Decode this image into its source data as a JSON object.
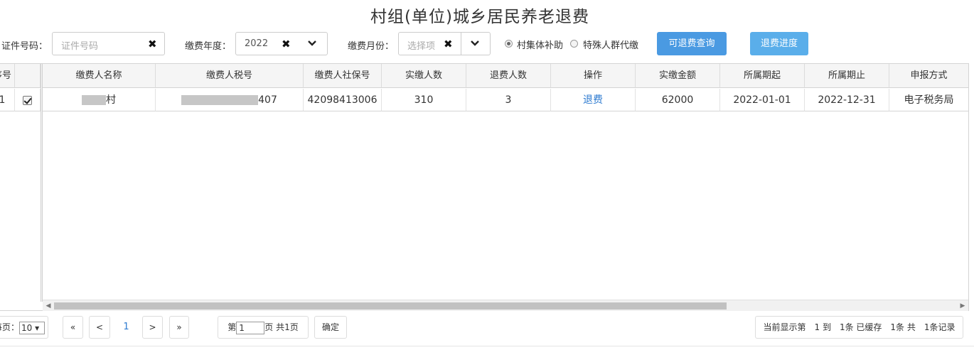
{
  "title": "村组(单位)城乡居民养老退费",
  "filters": {
    "id_label": "证件号码：",
    "id_placeholder": "证件号码",
    "year_label": "缴费年度：",
    "year_value": "2022",
    "month_label": "缴费月份：",
    "month_placeholder": "选择项",
    "radio1": "村集体补助",
    "radio2": "特殊人群代缴",
    "btn_query": "可退费查询",
    "btn_progress": "退费进度"
  },
  "table": {
    "headers": {
      "seq": "序号",
      "name": "缴费人名称",
      "tax": "缴费人税号",
      "ssn": "缴费人社保号",
      "paid_count": "实缴人数",
      "refund_count": "退费人数",
      "op": "操作",
      "amount": "实缴金额",
      "start": "所属期起",
      "end": "所属期止",
      "method": "申报方式"
    },
    "row": {
      "seq": "1",
      "name_suffix": "村",
      "tax_suffix": "407",
      "ssn": "42098413006",
      "paid_count": "310",
      "refund_count": "3",
      "op": "退费",
      "amount": "62000",
      "start": "2022-01-01",
      "end": "2022-12-31",
      "method": "电子税务局"
    }
  },
  "pager": {
    "per_page_label": "每页：",
    "per_page_value": "10",
    "first": "«",
    "prev": "<",
    "current": "1",
    "next": ">",
    "last": "»",
    "page_prefix": "第",
    "page_value": "1",
    "page_suffix": "页 共1页",
    "confirm": "确定",
    "status": "当前显示第　1 到　1条 已缓存　1条 共　1条记录"
  }
}
